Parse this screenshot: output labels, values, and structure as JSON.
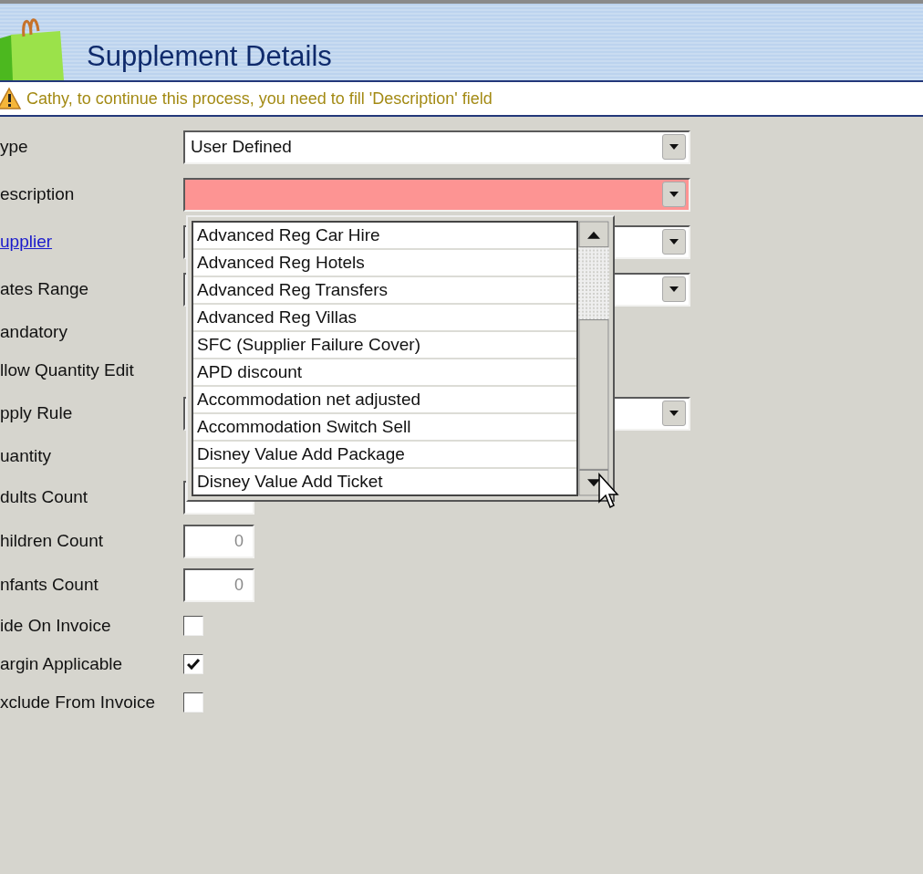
{
  "header": {
    "title": "Supplement Details"
  },
  "warning": {
    "text": "Cathy, to continue this process, you need to fill 'Description' field"
  },
  "fields": [
    {
      "label": "ype",
      "kind": "combo",
      "value": "User Defined",
      "invalid": false
    },
    {
      "label": "escription",
      "kind": "combo",
      "invalid": true
    },
    {
      "label": "upplier",
      "kind": "combo",
      "link": true,
      "invalid": false
    },
    {
      "label": "ates Range",
      "kind": "combo",
      "invalid": false
    },
    {
      "label": "andatory",
      "kind": "none"
    },
    {
      "label": "llow Quantity Edit",
      "kind": "none"
    },
    {
      "label": "pply Rule",
      "kind": "combo",
      "invalid": false
    },
    {
      "label": "uantity",
      "kind": "none"
    },
    {
      "label": "dults Count",
      "kind": "number"
    },
    {
      "label": "hildren Count",
      "kind": "number",
      "value": "0"
    },
    {
      "label": "nfants Count",
      "kind": "number",
      "value": "0"
    },
    {
      "label": "ide On Invoice",
      "kind": "check",
      "checked": false
    },
    {
      "label": "argin Applicable",
      "kind": "check",
      "checked": true
    },
    {
      "label": "xclude From Invoice",
      "kind": "check",
      "checked": false
    }
  ],
  "dropdown": {
    "items": [
      "Advanced Reg Car Hire",
      "Advanced Reg Hotels",
      "Advanced Reg Transfers",
      "Advanced Reg Villas",
      "SFC (Supplier Failure Cover)",
      "APD discount",
      "Accommodation net adjusted",
      "Accommodation Switch Sell",
      "Disney Value Add Package",
      "Disney Value Add Ticket"
    ]
  }
}
